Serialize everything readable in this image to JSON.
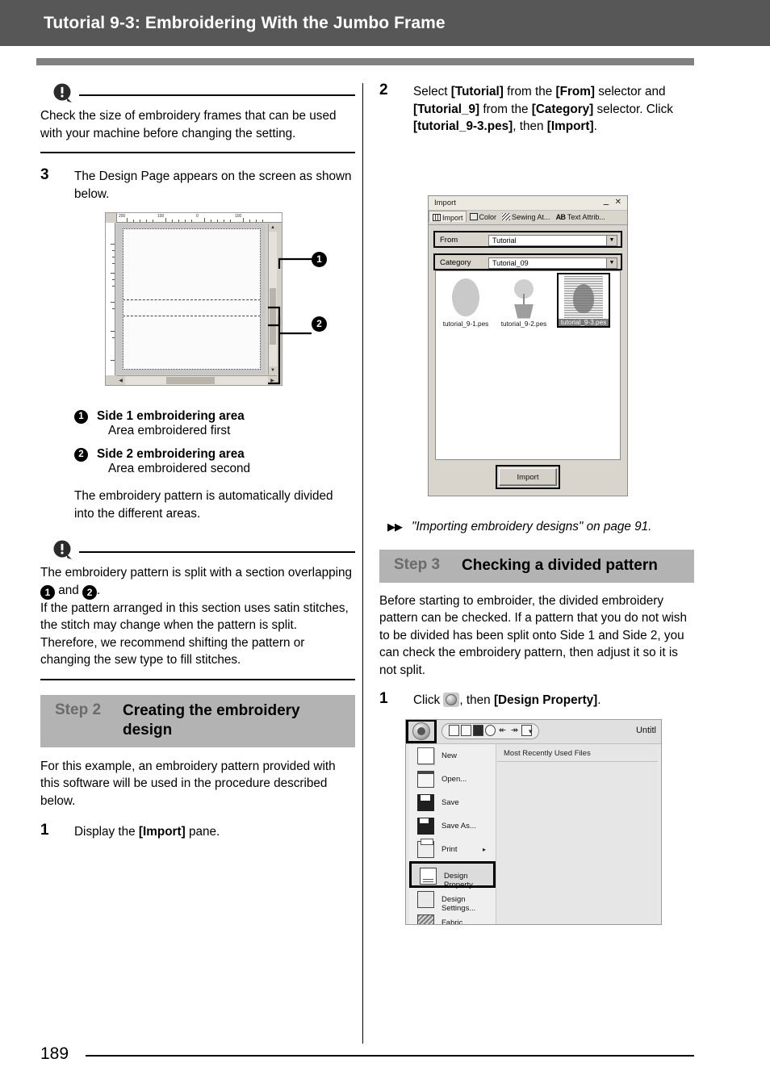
{
  "header": {
    "title": "Tutorial 9-3: Embroidering With the Jumbo Frame"
  },
  "footer": {
    "page_number": "189"
  },
  "colors": {
    "header_bg": "#575757",
    "accent_bar": "#808080",
    "step_band": "#b3b3b3",
    "step_label": "#6b6b6b"
  },
  "left_column": {
    "note1": {
      "icon": "note-exclamation-icon",
      "text": "Check the size of embroidery frames that can be used with your machine before changing the setting."
    },
    "step3": {
      "number": "3",
      "text": "The Design Page appears on the screen as shown below."
    },
    "design_page_figure": {
      "name": "design-page-screenshot",
      "ruler_labels": [
        "200",
        "100",
        "0",
        "100"
      ],
      "marker1": "1",
      "marker2": "2",
      "scroll_arrow_up": "▲",
      "scroll_arrow_down": "▼",
      "scroll_arrow_left": "◀",
      "scroll_arrow_right": "▶"
    },
    "callouts": [
      {
        "marker": "1",
        "title": "Side 1 embroidering area",
        "subtitle": "Area embroidered first"
      },
      {
        "marker": "2",
        "title": "Side 2 embroidering area",
        "subtitle": "Area embroidered second"
      }
    ],
    "after_callouts": "The embroidery pattern is automatically divided into the different areas.",
    "note2": {
      "icon": "note-exclamation-icon",
      "line1_a": "The embroidery pattern is split with a section overlapping ",
      "marker1": "1",
      "line1_b": " and ",
      "marker2": "2",
      "line1_c": ".",
      "line2": "If the pattern arranged in this section uses satin stitches, the stitch may change when the pattern is split. Therefore, we recommend shifting the pattern or changing the sew type to fill stitches."
    },
    "step2_heading": {
      "label": "Step 2",
      "title": "Creating the embroidery design"
    },
    "step2_intro": "For this example, an embroidery pattern provided with this software will be used in the procedure described below.",
    "step2_item1": {
      "number": "1",
      "text_a": "Display the ",
      "bold": "[Import]",
      "text_b": " pane."
    }
  },
  "right_column": {
    "step2_item2": {
      "number": "2",
      "seg1": "Select ",
      "b1": "[Tutorial]",
      "seg2": " from the ",
      "b2": "[From]",
      "seg3": " selector and ",
      "b3": "[Tutorial_9]",
      "seg4": " from the ",
      "b4": "[Category]",
      "seg5": " selector. Click ",
      "b5": "[tutorial_9-3.pes]",
      "seg6": ", then ",
      "b6": "[Import]",
      "seg7": "."
    },
    "import_dialog": {
      "name": "import-pane-screenshot",
      "title": "Import",
      "pin_icon": "pin-icon",
      "close_icon": "close-icon",
      "tabs": [
        {
          "label": "Import",
          "icon": "grid-icon",
          "active": true
        },
        {
          "label": "Color",
          "icon": "color-icon",
          "active": false
        },
        {
          "label": "Sewing At...",
          "icon": "sewing-attributes-icon",
          "active": false
        },
        {
          "label": "Text Attrib...",
          "icon": "ab-text-icon",
          "active": false
        }
      ],
      "fields": [
        {
          "label": "From",
          "value": "Tutorial"
        },
        {
          "label": "Category",
          "value": "Tutorial_09"
        }
      ],
      "thumbnails": [
        {
          "caption": "tutorial_9-1.pes",
          "selected": false
        },
        {
          "caption": "tutorial_9-2.pes",
          "selected": false
        },
        {
          "caption": "tutorial_9-3.pes",
          "selected": true
        }
      ],
      "import_button": "Import"
    },
    "xref": {
      "arrows": "▶▶",
      "text": "\"Importing embroidery designs\" on page 91."
    },
    "step3_heading": {
      "label": "Step 3",
      "title": "Checking a divided pattern"
    },
    "step3_intro": "Before starting to embroider, the divided embroidery pattern can be checked. If a pattern that you do not wish to be divided has been split onto Side 1 and Side 2, you can check the embroidery pattern, then adjust it so it is not split.",
    "step3_item1": {
      "number": "1",
      "text_a": "Click ",
      "icon": "application-button-orb-icon",
      "text_b": ", then ",
      "bold": "[Design Property]",
      "text_c": "."
    },
    "app_menu": {
      "name": "application-menu-screenshot",
      "orb_icon": "application-button-orb-icon",
      "quick_access_icons": [
        "new-icon",
        "open-icon",
        "save-icon",
        "zoom-icon",
        "undo-icon",
        "redo-icon",
        "list-icon"
      ],
      "dropdown_icon": "▾",
      "window_title": "Untitl",
      "recent_header": "Most Recently Used Files",
      "items": [
        {
          "label": "New",
          "icon": "new-page-icon",
          "selected": false,
          "submenu": ""
        },
        {
          "label": "Open...",
          "icon": "open-folder-icon",
          "selected": false,
          "submenu": ""
        },
        {
          "label": "Save",
          "icon": "save-disk-icon",
          "selected": false,
          "submenu": ""
        },
        {
          "label": "Save As...",
          "icon": "save-as-icon",
          "selected": false,
          "submenu": ""
        },
        {
          "label": "Print",
          "icon": "print-icon",
          "selected": false,
          "submenu": "▸"
        },
        {
          "label": "Design Property",
          "icon": "design-property-icon",
          "selected": true,
          "submenu": ""
        },
        {
          "label": "Design Settings...",
          "icon": "design-settings-icon",
          "selected": false,
          "submenu": ""
        },
        {
          "label": "Fabric Selector...",
          "icon": "fabric-selector-icon",
          "selected": false,
          "submenu": ""
        }
      ]
    }
  }
}
